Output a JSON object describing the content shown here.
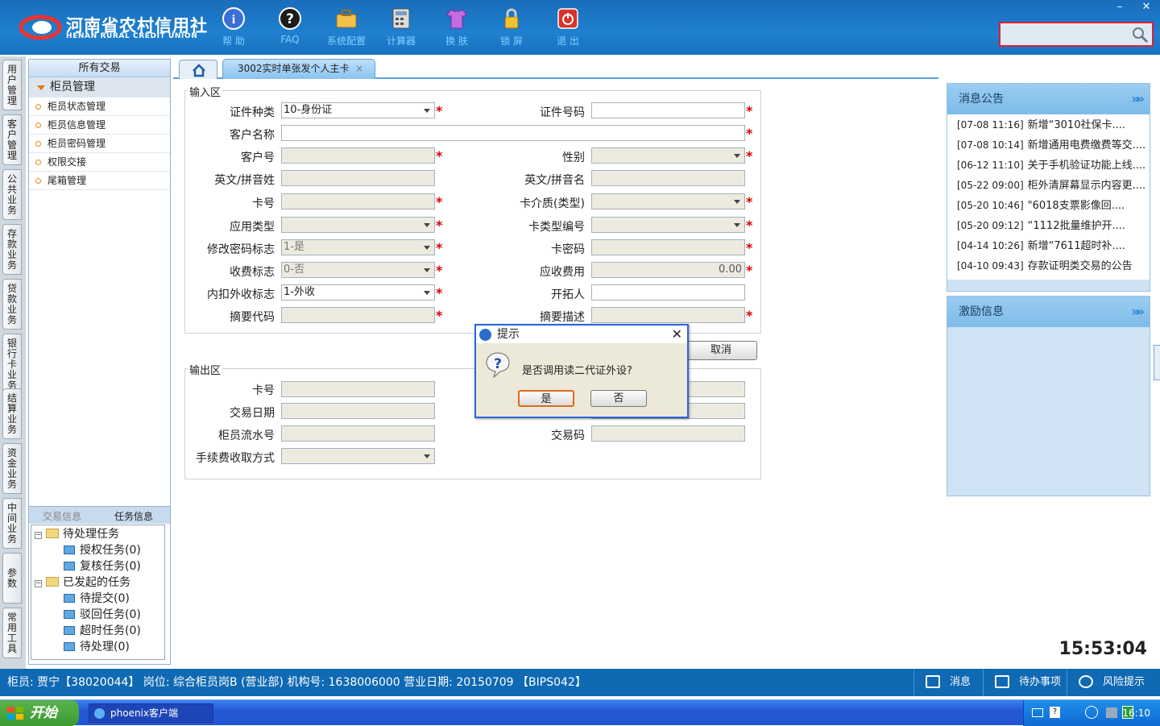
{
  "header": {
    "logo_cn": "河南省农村信用社",
    "logo_en": "HENAN RURAL CREDIT UNION",
    "toolbar": [
      {
        "label": "帮 助",
        "icon": "info-icon"
      },
      {
        "label": "FAQ",
        "icon": "question-icon"
      },
      {
        "label": "系统配置",
        "icon": "toolbox-icon"
      },
      {
        "label": "计算器",
        "icon": "calculator-icon"
      },
      {
        "label": "换 肤",
        "icon": "shirt-icon"
      },
      {
        "label": "锁 屏",
        "icon": "lock-icon"
      },
      {
        "label": "退 出",
        "icon": "power-icon"
      }
    ],
    "win_min": "–",
    "win_close": "✕",
    "search_value": ""
  },
  "vertical_tabs": [
    "用户管理",
    "客户管理",
    "公共业务",
    "存款业务",
    "贷款业务",
    "银行卡业务",
    "结算业务",
    "资金业务",
    "中间业务",
    "参数",
    "常用工具"
  ],
  "left_panel": {
    "title": "所有交易",
    "section": "柜员管理",
    "items": [
      "柜员状态管理",
      "柜员信息管理",
      "柜员密码管理",
      "权限交接",
      "尾箱管理"
    ],
    "tab_trade": "交易信息",
    "tab_task": "任务信息",
    "tree": {
      "pending": "待处理任务",
      "auth": "授权任务(0)",
      "review": "复核任务(0)",
      "initiated": "已发起的任务",
      "submit": "待提交(0)",
      "rejected": "驳回任务(0)",
      "timeout": "超时任务(0)",
      "todo": "待处理(0)"
    }
  },
  "tabs": {
    "active": "3002实时单张发个人主卡",
    "close": "×"
  },
  "input_area": {
    "legend": "输入区",
    "id_type_label": "证件种类",
    "id_type_value": "10-身份证",
    "id_no_label": "证件号码",
    "cust_name_label": "客户名称",
    "cust_no_label": "客户号",
    "gender_label": "性别",
    "en_last_label": "英文/拼音姓",
    "en_first_label": "英文/拼音名",
    "card_no_label": "卡号",
    "card_media_label": "卡介质(类型)",
    "app_type_label": "应用类型",
    "card_type_no_label": "卡类型编号",
    "pwd_flag_label": "修改密码标志",
    "pwd_flag_value": "1-是",
    "card_pwd_label": "卡密码",
    "fee_flag_label": "收费标志",
    "fee_flag_value": "0-否",
    "fee_due_label": "应收费用",
    "fee_due_value": "0.00",
    "inner_outer_label": "内扣外收标志",
    "inner_outer_value": "1-外收",
    "developer_label": "开拓人",
    "summary_code_label": "摘要代码",
    "summary_desc_label": "摘要描述",
    "required_mark": "*"
  },
  "cancel_button": "取消",
  "output_area": {
    "legend": "输出区",
    "card_no_label": "卡号",
    "trade_date_label": "交易日期",
    "teller_serial_label": "柜员流水号",
    "trade_code_label": "交易码",
    "fee_method_label": "手续费收取方式"
  },
  "dialog": {
    "title": "提示",
    "message": "是否调用读二代证外设?",
    "yes": "是",
    "no": "否",
    "close": "✕"
  },
  "notice_panel": {
    "title": "消息公告",
    "arrows": "»»",
    "items": [
      {
        "time": "[07-08 11:16]",
        "text": "新增“3010社保卡...."
      },
      {
        "time": "[07-08 10:14]",
        "text": "新增通用电费缴费等交...."
      },
      {
        "time": "[06-12 11:10]",
        "text": "关于手机验证功能上线...."
      },
      {
        "time": "[05-22 09:00]",
        "text": "柜外清屏幕显示内容更...."
      },
      {
        "time": "[05-20 10:46]",
        "text": "\"6018支票影像回...."
      },
      {
        "time": "[05-20 09:12]",
        "text": "“1112批量维护开...."
      },
      {
        "time": "[04-14 10:26]",
        "text": "新增“7611超时补...."
      },
      {
        "time": "[04-10 09:43]",
        "text": "存款证明类交易的公告"
      }
    ]
  },
  "incentive_panel": {
    "title": "激励信息",
    "arrows": "»»"
  },
  "clock": "15:53:04",
  "status_bar": {
    "text": "柜员: 贾宁【38020044】 岗位: 综合柜员岗B (营业部)   机构号: 1638006000   营业日期: 20150709  【BIPS042】",
    "msg": "消息",
    "todo": "待办事项",
    "risk": "风险提示"
  },
  "taskbar": {
    "start": "开始",
    "app": "phoenix客户端",
    "time": "16:10"
  }
}
